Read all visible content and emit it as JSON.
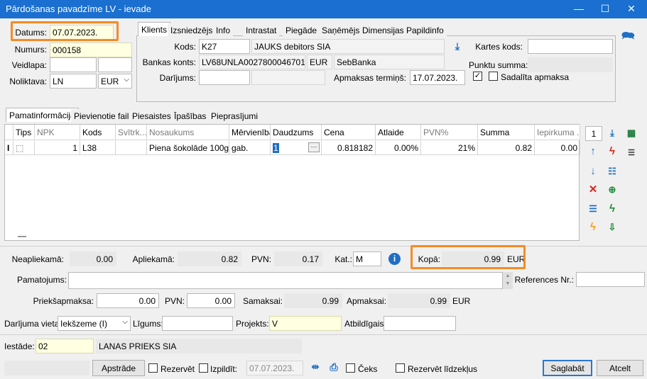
{
  "window": {
    "title": "Pārdošanas pavadzīme LV - ievade",
    "minimize": "—",
    "maximize": "☐",
    "close": "✕"
  },
  "header": {
    "datums_label": "Datums:",
    "datums_value": "07.07.2023.",
    "numurs_label": "Numurs:",
    "numurs_value": "000158",
    "veidlapa_label": "Veidlapa:",
    "veidlapa_value": "",
    "noliktava_label": "Noliktava:",
    "noliktava_value": "LN",
    "currency_value": "EUR"
  },
  "top_tabs": [
    "Klients",
    "Izsniedzējs",
    "Info",
    "Intrastat",
    "Piegāde",
    "Saņēmējs",
    "Dimensijas",
    "Papildinfo"
  ],
  "client": {
    "kods_label": "Kods:",
    "kods_value": "K27",
    "name_value": "JAUKS debitors SIA",
    "bank_label": "Bankas konts:",
    "bank_value": "LV68UNLA0027800046701",
    "bank_currency": "EUR",
    "bank_name": "SebBanka",
    "darijums_label": "Darījums:",
    "darijums_value": "",
    "apmaksas_termins_label": "Apmaksas termiņš:",
    "apmaksas_termins_value": "17.07.2023.",
    "kartes_kods_label": "Kartes kods:",
    "kartes_kods_value": "",
    "punktu_summa_label": "Punktu summa:",
    "punktu_summa_value": "",
    "sadalita_label": "Sadalīta apmaksa"
  },
  "main_tabs": [
    "Pamatinformācija",
    "Pievienotie faili",
    "Piesaistes",
    "Īpašības",
    "Pieprasījumi"
  ],
  "grid": {
    "columns": [
      "Tips",
      "NPK",
      "Kods",
      "Svītrk...",
      "Nosaukums",
      "Mērvienība",
      "Daudzums",
      "Cena",
      "Atlaide",
      "PVN%",
      "Summa",
      "Iepirkuma ..."
    ],
    "rows": [
      {
        "marker": "I",
        "tips": "",
        "npk": "1",
        "kods": "L38",
        "svitrk": "",
        "nosaukums": "Piena šokolāde 100g",
        "merv": "gab.",
        "daudzums": "1",
        "cena": "0.818182",
        "atlaide": "0.00%",
        "pvn": "21%",
        "summa": "0.82",
        "iepirkuma": "0.00"
      }
    ],
    "footer_mark": "—"
  },
  "side_toolbar": {
    "counter": "1"
  },
  "totals": {
    "neapliekama_label": "Neapliekamā:",
    "neapliekama_value": "0.00",
    "apliekama_label": "Apliekamā:",
    "apliekama_value": "0.82",
    "pvn_label": "PVN:",
    "pvn_value": "0.17",
    "kat_label": "Kat.:",
    "kat_value": "M",
    "kopa_label": "Kopā:",
    "kopa_value": "0.99",
    "kopa_currency": "EUR"
  },
  "pamatojums_label": "Pamatojums:",
  "pamatojums_value": "",
  "references_label": "References Nr.:",
  "references_value": "",
  "payment": {
    "priekssapmaksa_label": "Priekšapmaksa:",
    "priekssapmaksa_value": "0.00",
    "pvn_label": "PVN:",
    "pvn_value": "0.00",
    "samaksai_label": "Samaksai:",
    "samaksai_value": "0.99",
    "apmaksai_label": "Apmaksai:",
    "apmaksai_value": "0.99",
    "apmaksai_currency": "EUR"
  },
  "deal": {
    "vieta_label": "Darījuma vieta:",
    "vieta_value": "Iekšzeme (I)",
    "ligums_label": "Līgums:",
    "ligums_value": "",
    "projekts_label": "Projekts:",
    "projekts_value": "V",
    "atbildigais_label": "Atbildīgais:",
    "atbildigais_value": ""
  },
  "iestade": {
    "label": "Iestāde:",
    "code": "02",
    "name": "LANAS PRIEKS SIA"
  },
  "bottom": {
    "apstrade": "Apstrāde",
    "rezervet": "Rezervēt",
    "izpildit": "Izpildīt:",
    "izpildit_date": "07.07.2023.",
    "ceks": "Čeks",
    "rezervet_lidzeklus": "Rezervēt līdzekļus",
    "saglabat": "Saglabāt",
    "atcelt": "Atcelt"
  },
  "colors": {
    "titlebar": "#1a6fd0",
    "highlight": "#f28c28",
    "input_yellow": "#ffffe1"
  }
}
